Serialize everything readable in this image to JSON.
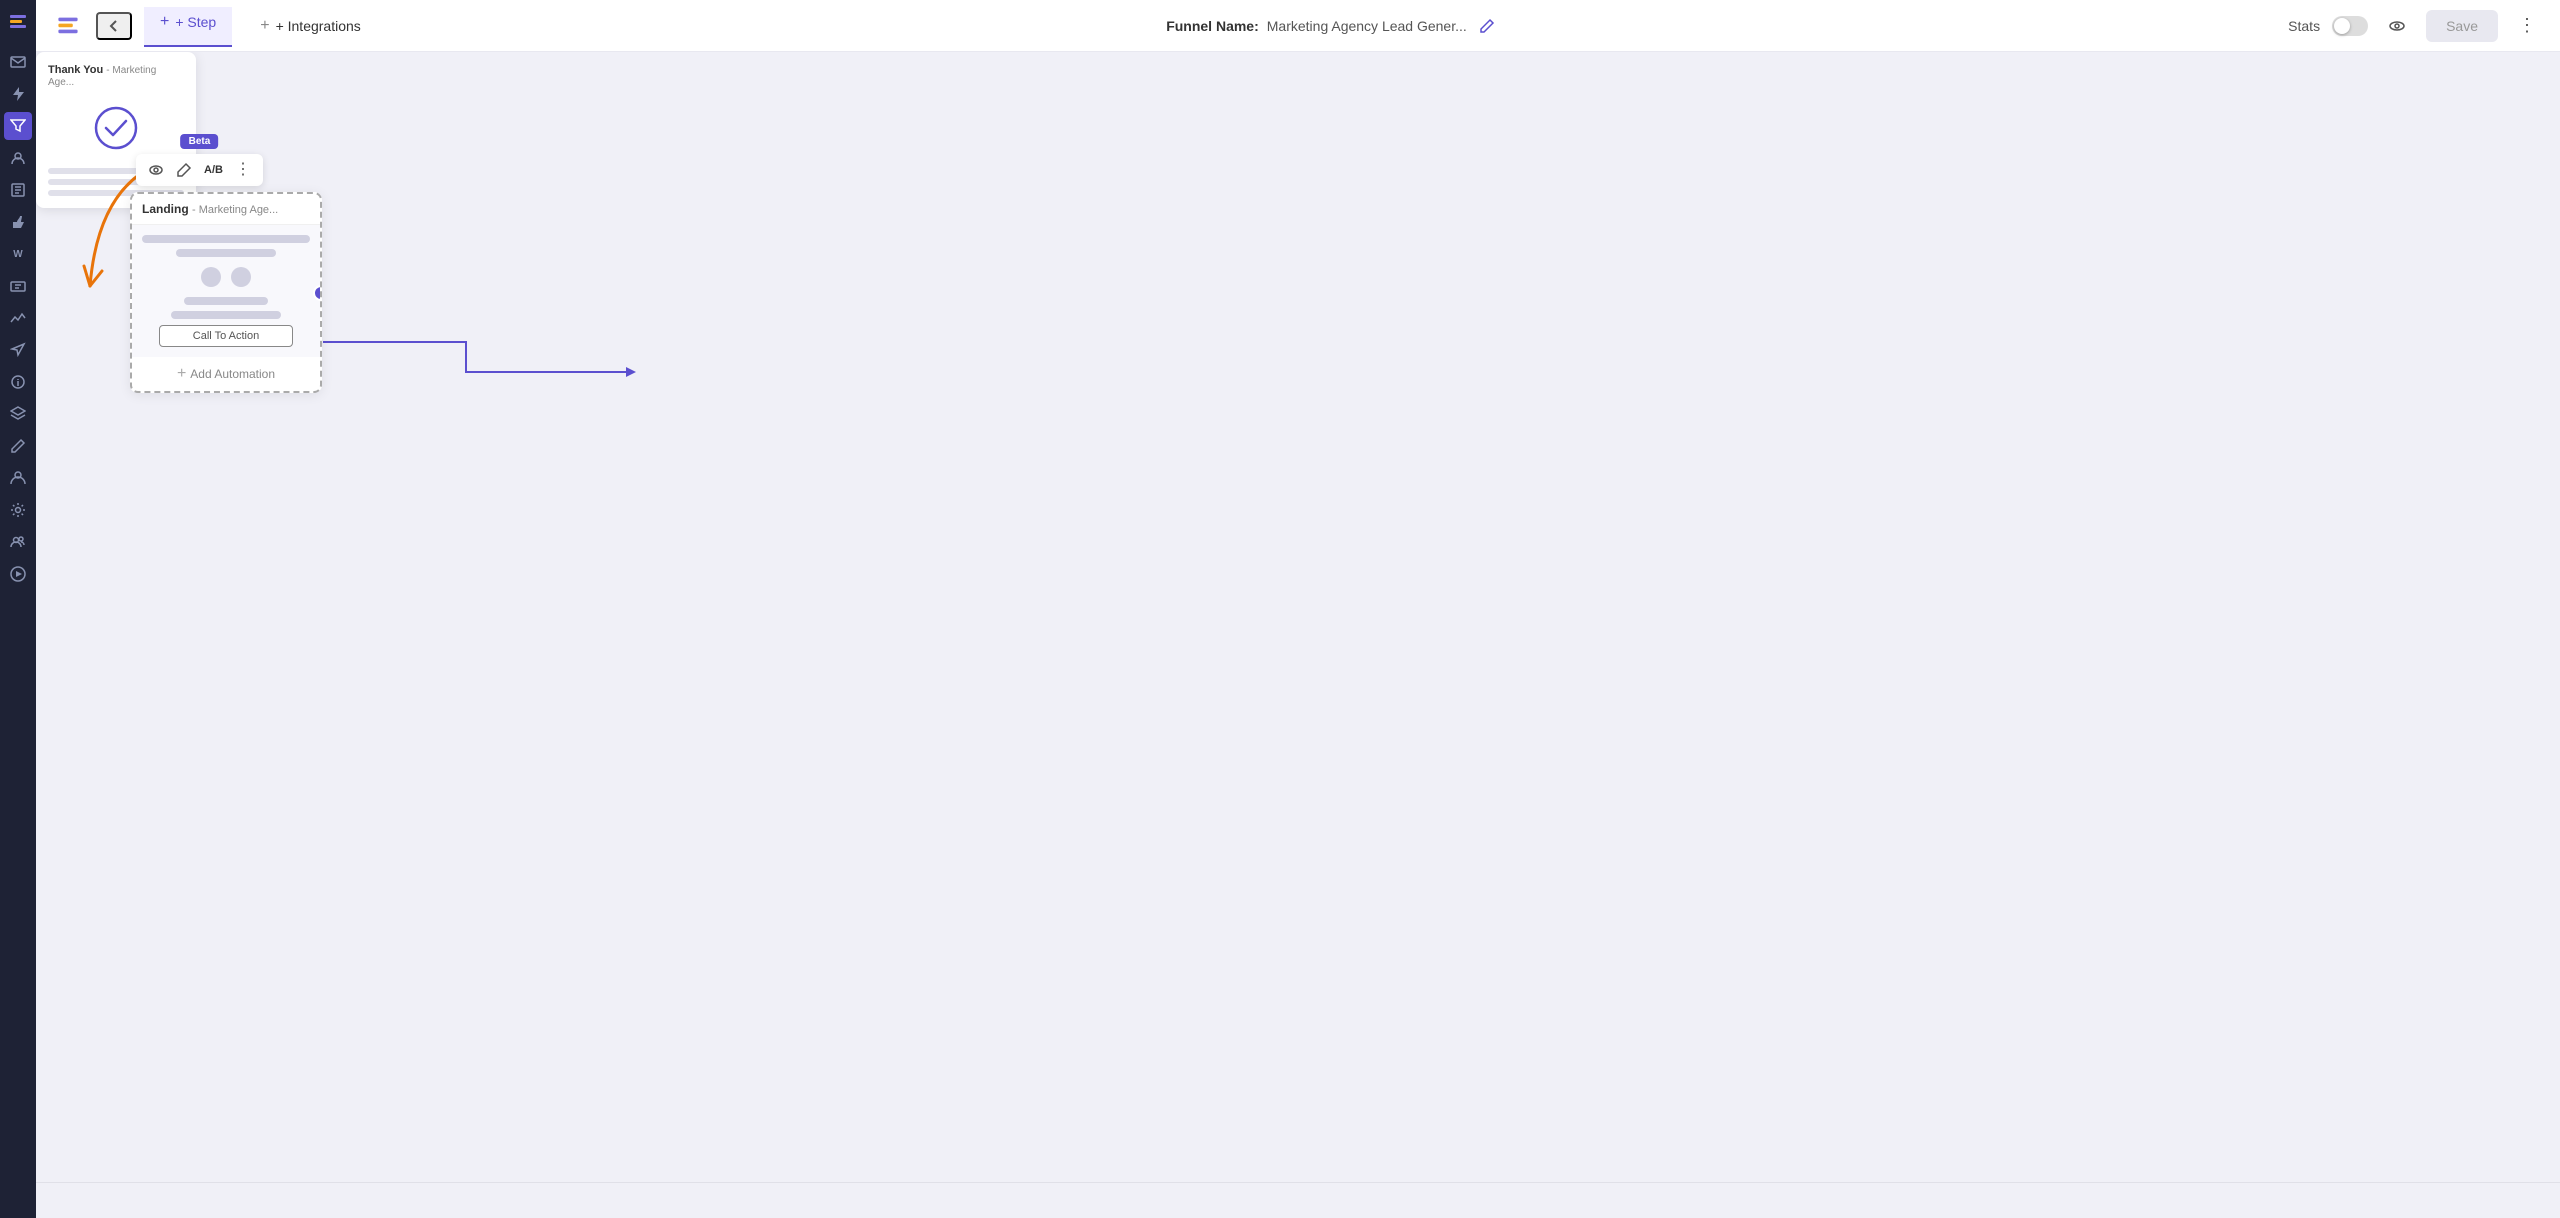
{
  "sidebar": {
    "icons": [
      {
        "name": "logo-icon",
        "symbol": "≡"
      },
      {
        "name": "mail-icon",
        "symbol": "✉"
      },
      {
        "name": "lightning-icon",
        "symbol": "⚡"
      },
      {
        "name": "star-icon",
        "symbol": "★"
      },
      {
        "name": "pages-icon",
        "symbol": "▣"
      },
      {
        "name": "thumbs-down-icon",
        "symbol": "👎"
      },
      {
        "name": "woo-icon",
        "symbol": "W"
      },
      {
        "name": "lines-icon",
        "symbol": "☰"
      },
      {
        "name": "chart-icon",
        "symbol": "📊"
      },
      {
        "name": "megaphone-icon",
        "symbol": "📣"
      },
      {
        "name": "info-icon",
        "symbol": "ℹ"
      },
      {
        "name": "layers-icon",
        "symbol": "⧉"
      },
      {
        "name": "pen-icon",
        "symbol": "✏"
      },
      {
        "name": "user-icon",
        "symbol": "👤"
      },
      {
        "name": "wrench-icon",
        "symbol": "🔧"
      },
      {
        "name": "users-icon",
        "symbol": "👥"
      },
      {
        "name": "play-icon",
        "symbol": "▶"
      }
    ]
  },
  "topbar": {
    "back_label": "←",
    "step_label": "+ Step",
    "integrations_label": "+ Integrations",
    "funnel_name_label": "Funnel Name:",
    "funnel_name_value": "Marketing Agency Lead Gener...",
    "stats_label": "Stats",
    "save_label": "Save"
  },
  "canvas": {
    "landing_card": {
      "title": "Landing",
      "subtitle": "- Marketing Age...",
      "cta_label": "Call To Action",
      "add_automation_label": "Add Automation",
      "beta_label": "Beta",
      "ab_label": "A/B"
    },
    "thankyou_card": {
      "title": "Thank You",
      "subtitle": "- Marketing Age..."
    }
  },
  "colors": {
    "purple": "#5b4fcf",
    "orange": "#e8740a",
    "dark_sidebar": "#1e2235",
    "light_bg": "#f0f0f7"
  }
}
